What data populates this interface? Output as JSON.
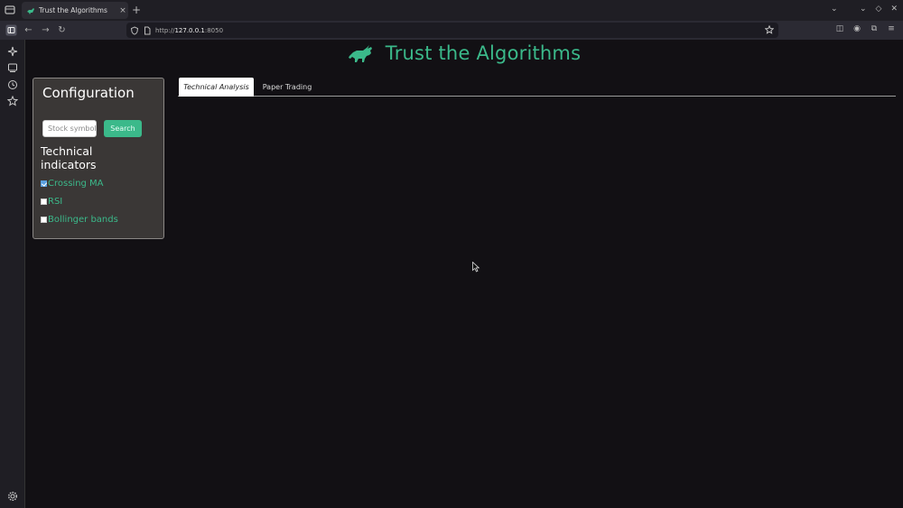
{
  "browser": {
    "tab_title": "Trust the Algorithms",
    "tab_close": "×",
    "new_tab": "+",
    "url_host": "127.0.0.1",
    "url_scheme": "http://",
    "url_port": ":8050",
    "window_controls": [
      "⌄",
      "–",
      "◇",
      "✕"
    ]
  },
  "app": {
    "title": "Trust the Algorithms",
    "accent_color": "#3bb98a"
  },
  "config": {
    "title": "Configuration",
    "search_placeholder": "Stock symbol",
    "search_button": "Search",
    "indicators_title": "Technical indicators",
    "indicators": [
      {
        "label": "Crossing MA",
        "checked": true
      },
      {
        "label": "RSI",
        "checked": false
      },
      {
        "label": "Bollinger bands",
        "checked": false
      }
    ]
  },
  "tabs": {
    "items": [
      {
        "label": "Technical Analysis",
        "active": true
      },
      {
        "label": "Paper Trading",
        "active": false
      }
    ]
  }
}
